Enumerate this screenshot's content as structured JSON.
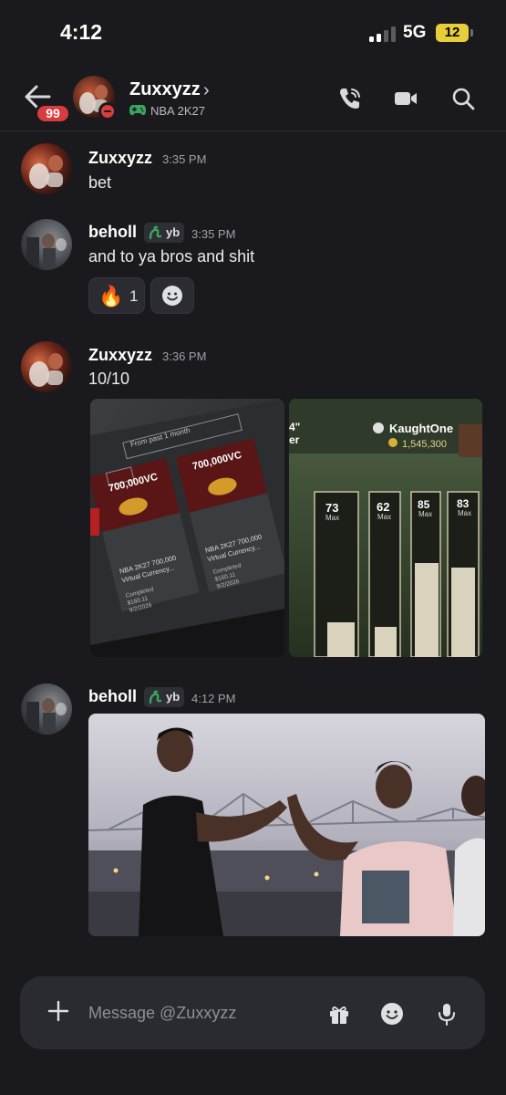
{
  "status_bar": {
    "time": "4:12",
    "network": "5G",
    "battery": "12"
  },
  "header": {
    "unread_badge": "99",
    "user_name": "Zuxxyzz",
    "game": "NBA 2K27"
  },
  "messages": [
    {
      "author": "Zuxxyzz",
      "time": "3:35 PM",
      "text": "bet"
    },
    {
      "author": "beholl",
      "tag": "yb",
      "time": "3:35 PM",
      "text": "and to ya bros and shit",
      "reactions": [
        {
          "emoji": "🔥",
          "count": "1"
        },
        {
          "emoji": "add-reaction-icon",
          "count": ""
        }
      ]
    },
    {
      "author": "Zuxxyzz",
      "time": "3:36 PM",
      "text": "10/10",
      "attachments": [
        {
          "kind": "photo",
          "filter": "From past 1 month",
          "cards": [
            {
              "pack": "700,000VC",
              "title": "NBA 2K27 700,000 Virtual Currency...",
              "status": "Completed",
              "price": "$160.11",
              "date": "9/2/2026"
            },
            {
              "pack": "700,000VC",
              "title": "NBA 2K27 700,000 Virtual Currency...",
              "status": "Completed",
              "price": "$160.11",
              "date": "9/2/2026"
            }
          ]
        },
        {
          "kind": "photo",
          "gamertag": "KaughtOne",
          "vc_balance": "1,545,300",
          "stats": [
            {
              "value": "73",
              "label": "Max"
            },
            {
              "value": "62",
              "label": "Max"
            },
            {
              "value": "85",
              "label": "Max"
            },
            {
              "value": "83",
              "label": "Max"
            }
          ]
        }
      ]
    },
    {
      "author": "beholl",
      "tag": "yb",
      "time": "4:12 PM",
      "attachments": [
        {
          "kind": "photo"
        }
      ]
    }
  ],
  "composer": {
    "placeholder": "Message @Zuxxyzz"
  },
  "colors": {
    "background": "#1a1a1e",
    "badge_red": "#d83c3e",
    "tag_green": "#3ba55c",
    "battery_yellow": "#e8cd3a"
  }
}
